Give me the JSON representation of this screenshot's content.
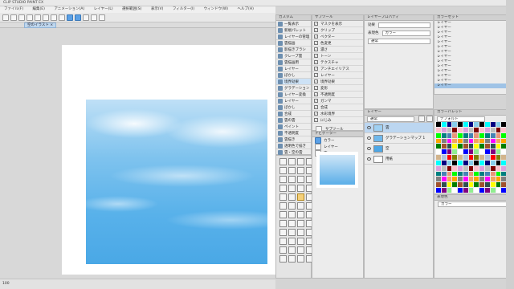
{
  "window": {
    "title": "CLIP STUDIO PAINT EX"
  },
  "menu": [
    "ファイル(F)",
    "編集(E)",
    "アニメーション(A)",
    "レイヤー(L)",
    "選択範囲(S)",
    "表示(V)",
    "フィルター(I)",
    "ウィンドウ(W)",
    "ヘルプ(H)"
  ],
  "document": {
    "tab_label": "空のイラスト"
  },
  "subtool": {
    "title": "カスタム",
    "items": [
      "一覧表示",
      "新規パレット",
      "レイヤーの管理",
      "雲描画",
      "影描きブラシ",
      "クレープ雲",
      "雲描画用",
      "レイヤー",
      "ぼかし",
      "境界効果",
      "グラデーション",
      "レイヤー変換",
      "レイヤー",
      "ぼかし",
      "合成",
      "雲の雲",
      "ペイント",
      "不透明度",
      "雲描き",
      "透明色で描き",
      "雲・空の雲",
      "トーン化",
      "クリップ"
    ]
  },
  "toolprop": {
    "title": "サブツール",
    "items": [
      "マスクを表示",
      "クリップ",
      "ベクター",
      "色変更",
      "濃さ",
      "トーン",
      "テクスチャ",
      "アンチエイリアス",
      "レイヤー",
      "境界効果",
      "変形",
      "不透明度",
      "ガンマ",
      "合成",
      "水彩境界",
      "にじみ"
    ],
    "footer": "サブツール"
  },
  "navigator": {
    "title": "ナビゲーター",
    "rows": [
      "カラー",
      "レイヤー",
      "空"
    ]
  },
  "layerprop": {
    "title": "レイヤープロパティ",
    "rows": [
      {
        "label": "効果",
        "value": ""
      },
      {
        "label": "表現色",
        "value": "カラー"
      },
      {
        "label": "",
        "value": "通常"
      }
    ]
  },
  "layers": {
    "title": "レイヤー",
    "blend": "通常",
    "rows": [
      {
        "name": "雲",
        "thumb": "#9fd0f3"
      },
      {
        "name": "グラデーションマップ 1",
        "thumb": "#6fb8ec"
      },
      {
        "name": "空",
        "thumb": "#4ea7e6"
      },
      {
        "name": "用紙",
        "thumb": "#ffffff"
      }
    ]
  },
  "colorsets": {
    "title": "カラーセット",
    "items": [
      "レイヤー",
      "レイヤー",
      "レイヤー",
      "レイヤー",
      "レイヤー",
      "レイヤー",
      "レイヤー",
      "レイヤー",
      "レイヤー",
      "レイヤー",
      "レイヤー",
      "レイヤー",
      "レイヤー",
      "レイヤー"
    ]
  },
  "palette": {
    "title": "カラーパレット",
    "dropdown": "デフォルト"
  },
  "colorwheel": {
    "title": "表現色",
    "mode": "カラー"
  },
  "status": {
    "zoom": "100"
  },
  "colors": {
    "accent": "#5aa0e6",
    "selection": "#bcd6f0"
  }
}
